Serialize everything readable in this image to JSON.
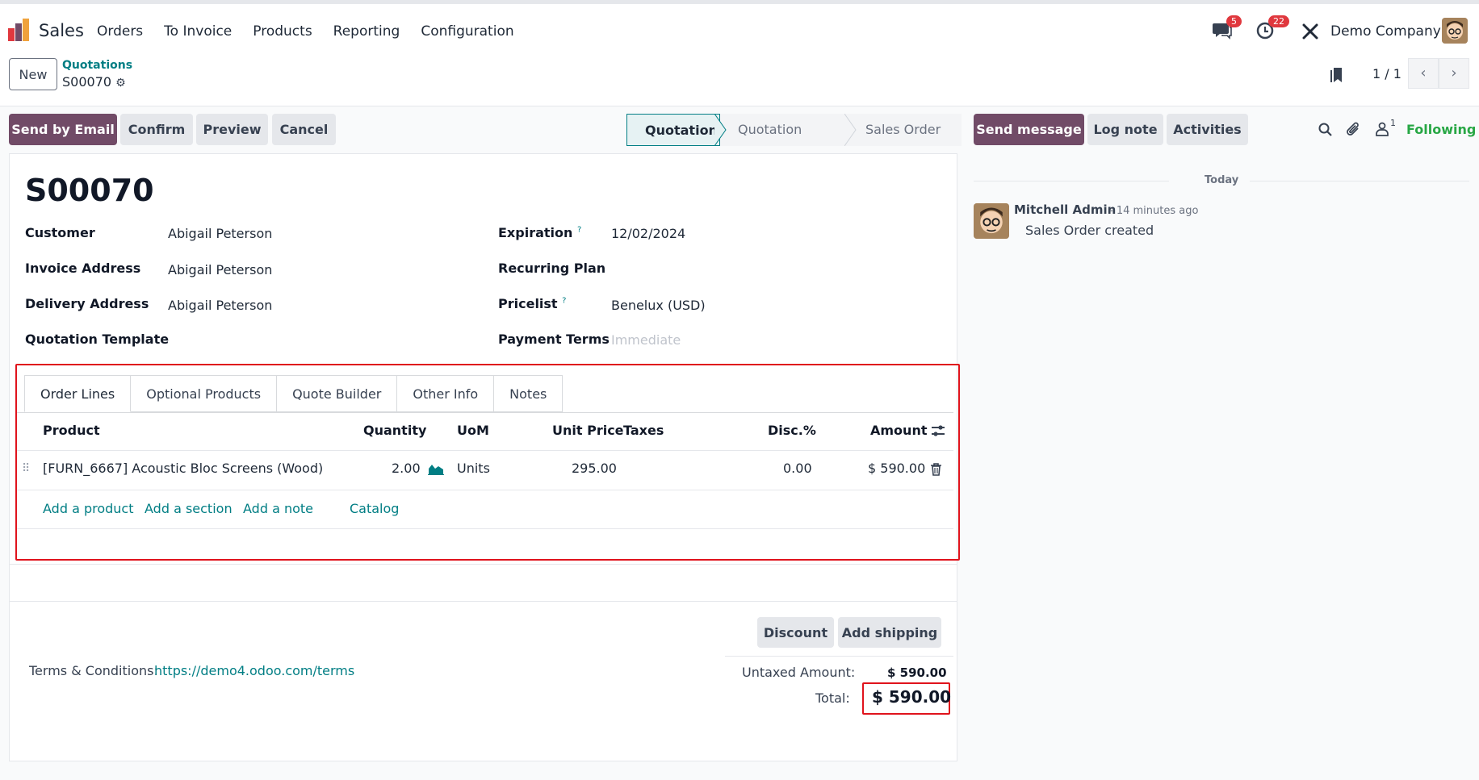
{
  "nav": {
    "app_name": "Sales",
    "menu": [
      "Orders",
      "To Invoice",
      "Products",
      "Reporting",
      "Configuration"
    ],
    "messages_count": "5",
    "activities_count": "22",
    "company": "Demo Company"
  },
  "control": {
    "new_label": "New",
    "breadcrumb_parent": "Quotations",
    "breadcrumb_current": "S00070",
    "pager": "1 / 1"
  },
  "actions": {
    "send_email": "Send by Email",
    "confirm": "Confirm",
    "preview": "Preview",
    "cancel": "Cancel"
  },
  "status": {
    "stages": [
      "Quotation",
      "Quotation Sent",
      "Sales Order"
    ],
    "active": "Quotation"
  },
  "form": {
    "title": "S00070",
    "customer_label": "Customer",
    "customer": "Abigail Peterson",
    "invoice_address_label": "Invoice Address",
    "invoice_address": "Abigail Peterson",
    "delivery_address_label": "Delivery Address",
    "delivery_address": "Abigail Peterson",
    "template_label": "Quotation Template",
    "expiration_label": "Expiration",
    "expiration": "12/02/2024",
    "recurring_label": "Recurring Plan",
    "pricelist_label": "Pricelist",
    "pricelist": "Benelux (USD)",
    "payment_terms_label": "Payment Terms",
    "payment_terms_placeholder": "Immediate",
    "help_mark": "?"
  },
  "tabs": [
    "Order Lines",
    "Optional Products",
    "Quote Builder",
    "Other Info",
    "Notes"
  ],
  "table": {
    "headers": {
      "product": "Product",
      "quantity": "Quantity",
      "uom": "UoM",
      "unit_price": "Unit Price",
      "taxes": "Taxes",
      "disc": "Disc.%",
      "amount": "Amount"
    },
    "rows": [
      {
        "product": "[FURN_6667] Acoustic Bloc Screens (Wood)",
        "quantity": "2.00",
        "uom": "Units",
        "unit_price": "295.00",
        "taxes": "",
        "disc": "0.00",
        "amount": "$ 590.00"
      }
    ],
    "add_product": "Add a product",
    "add_section": "Add a section",
    "add_note": "Add a note",
    "catalog": "Catalog"
  },
  "footer": {
    "discount": "Discount",
    "add_shipping": "Add shipping",
    "terms_label": "Terms & Conditions:",
    "terms_link": "https://demo4.odoo.com/terms",
    "untaxed_label": "Untaxed Amount:",
    "untaxed": "$ 590.00",
    "total_label": "Total:",
    "total": "$ 590.00"
  },
  "chatter": {
    "send_message": "Send message",
    "log_note": "Log note",
    "activities": "Activities",
    "followers_count": "1",
    "following": "Following",
    "date_separator": "Today",
    "author": "Mitchell Admin",
    "time": "- 14 minutes ago",
    "message": "Sales Order created"
  },
  "colors": {
    "primary": "#714b67",
    "link": "#017e84",
    "highlight_box": "#e0131c",
    "following": "#28a745"
  }
}
